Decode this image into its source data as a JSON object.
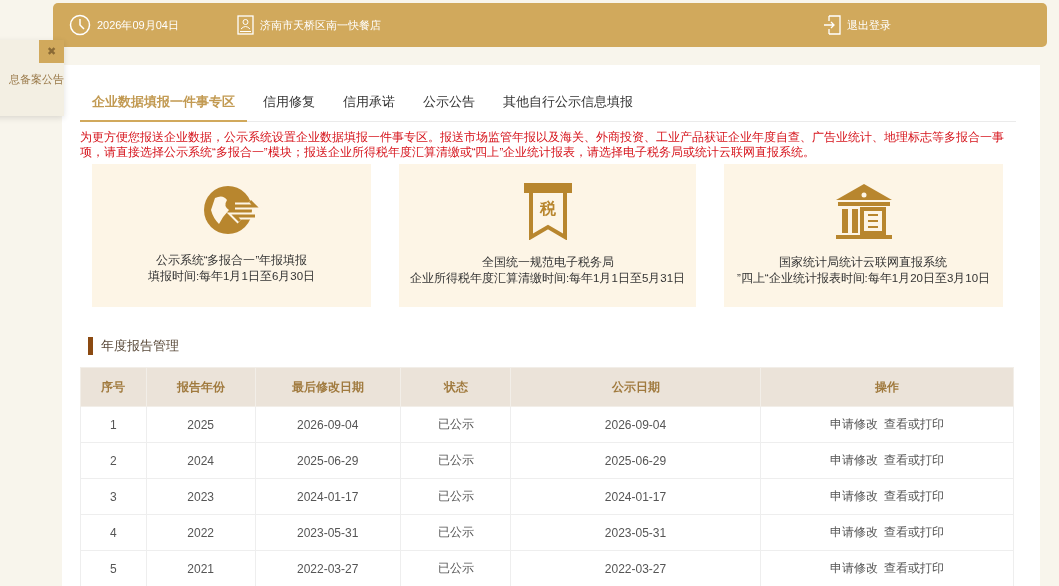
{
  "side_popup": {
    "close": "✖",
    "text": "息备案公告"
  },
  "header": {
    "date": "2026年09月04日",
    "shop": "济南市天桥区南一快餐店",
    "logout": "退出登录"
  },
  "tabs": [
    {
      "label": "企业数据填报一件事专区",
      "selected": true
    },
    {
      "label": "信用修复",
      "selected": false
    },
    {
      "label": "信用承诺",
      "selected": false
    },
    {
      "label": "公示公告",
      "selected": false
    },
    {
      "label": "其他自行公示信息填报",
      "selected": false
    }
  ],
  "notice": "为更方便您报送企业数据，公示系统设置企业数据填报一件事专区。报送市场监管年报以及海关、外商投资、工业产品获证企业年度自查、广告业统计、地理标志等多报合一事项，请直接选择公示系统“多报合一”模块；报送企业所得税年度汇算清缴或“四上”企业统计报表，请选择电子税务局或统计云联网直报系统。",
  "cards": [
    {
      "kind": "globe",
      "title": "公示系统“多报合一”年报填报",
      "subtitle": "填报时间:每年1月1日至6月30日"
    },
    {
      "kind": "tax",
      "icon_text": "税",
      "title": "全国统一规范电子税务局",
      "subtitle": "企业所得税年度汇算清缴时间:每年1月1日至5月31日"
    },
    {
      "kind": "bank",
      "title": "国家统计局统计云联网直报系统",
      "subtitle": "”四上“企业统计报表时间:每年1月20日至3月10日"
    }
  ],
  "section_title": "年度报告管理",
  "table": {
    "columns": [
      "序号",
      "报告年份",
      "最后修改日期",
      "状态",
      "公示日期",
      "操作"
    ],
    "rows": [
      {
        "cells": [
          "1",
          "2025",
          "2026-09-04",
          "已公示",
          "2026-09-04"
        ],
        "actions": [
          "申请修改",
          "查看或打印"
        ]
      },
      {
        "cells": [
          "2",
          "2024",
          "2025-06-29",
          "已公示",
          "2025-06-29"
        ],
        "actions": [
          "申请修改",
          "查看或打印"
        ]
      },
      {
        "cells": [
          "3",
          "2023",
          "2024-01-17",
          "已公示",
          "2024-01-17"
        ],
        "actions": [
          "申请修改",
          "查看或打印"
        ]
      },
      {
        "cells": [
          "4",
          "2022",
          "2023-05-31",
          "已公示",
          "2023-05-31"
        ],
        "actions": [
          "申请修改",
          "查看或打印"
        ]
      },
      {
        "cells": [
          "5",
          "2021",
          "2022-03-27",
          "已公示",
          "2022-03-27"
        ],
        "actions": [
          "申请修改",
          "查看或打印"
        ]
      }
    ]
  }
}
